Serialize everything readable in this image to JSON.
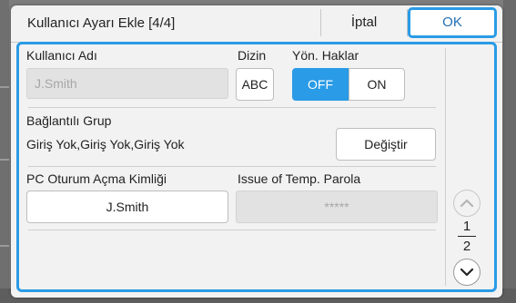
{
  "dialog": {
    "title": "Kullanıcı Ayarı Ekle [4/4]",
    "cancel_label": "İptal",
    "ok_label": "OK"
  },
  "user_name": {
    "label": "Kullanıcı Adı",
    "placeholder": "J.Smith"
  },
  "directory": {
    "label": "Dizin",
    "button_label": "ABC"
  },
  "admin_rights": {
    "label": "Yön. Haklar",
    "off_label": "OFF",
    "on_label": "ON",
    "selected": "OFF"
  },
  "linked_group": {
    "label": "Bağlantılı Grup",
    "value": "Giriş Yok,Giriş Yok,Giriş Yok",
    "change_label": "Değiştir"
  },
  "pc_login": {
    "label": "PC Oturum Açma Kimliği",
    "value": "J.Smith"
  },
  "temp_password": {
    "label": "Issue of Temp. Parola",
    "value": "*****"
  },
  "pagination": {
    "current": "1",
    "total": "2"
  },
  "colors": {
    "accent": "#2a9be6",
    "disabled_field": "#e2e2e2",
    "panel": "#f2f2f2"
  }
}
